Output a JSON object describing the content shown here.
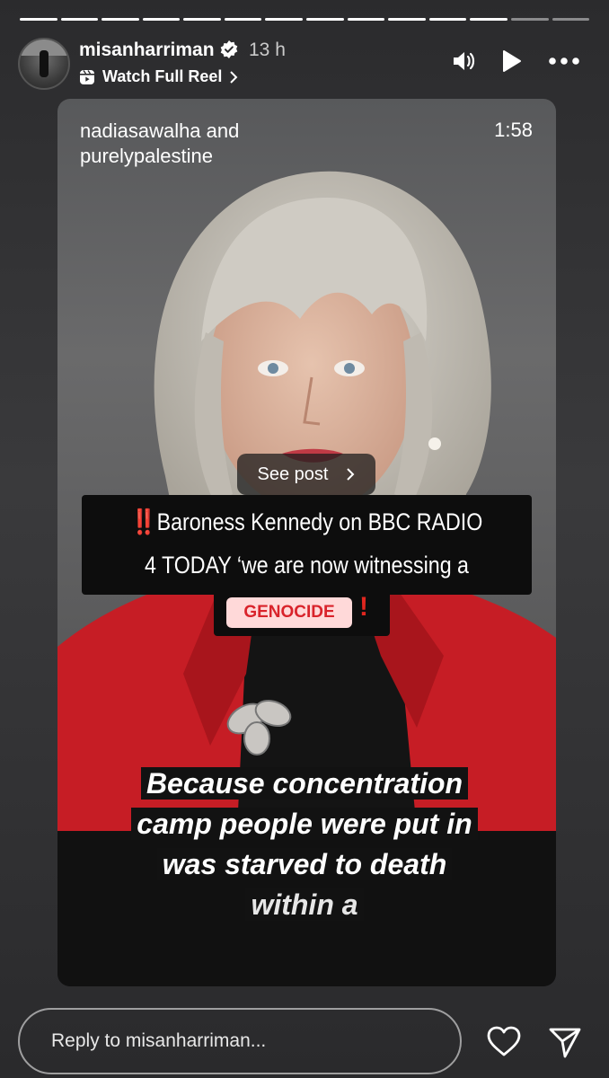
{
  "story": {
    "progress": {
      "segments": 14,
      "completed": 12
    },
    "author": "misanharriman",
    "time_ago": "13 h",
    "reel_link": "Watch Full Reel"
  },
  "card": {
    "author_line1": "nadiasawalha and",
    "author_line2": "purelypalestine",
    "duration": "1:58",
    "see_post": "See post",
    "caption_bang": "‼️",
    "caption_line1": "Baroness Kennedy on BBC RADIO",
    "caption_line2": "4 TODAY  ‘we are now witnessing a",
    "caption_highlight": "GENOCIDE",
    "caption_end_bang": "!",
    "subtitle_line1": "Because concentration",
    "subtitle_line2": "camp people were put in",
    "subtitle_line3": "was starved to death",
    "subtitle_line4": "within a"
  },
  "reply": {
    "placeholder": "Reply to misanharriman..."
  },
  "colors": {
    "accent_red": "#d9232b",
    "highlight_bg": "#ffd9d9",
    "jacket_red": "#c61d25"
  }
}
